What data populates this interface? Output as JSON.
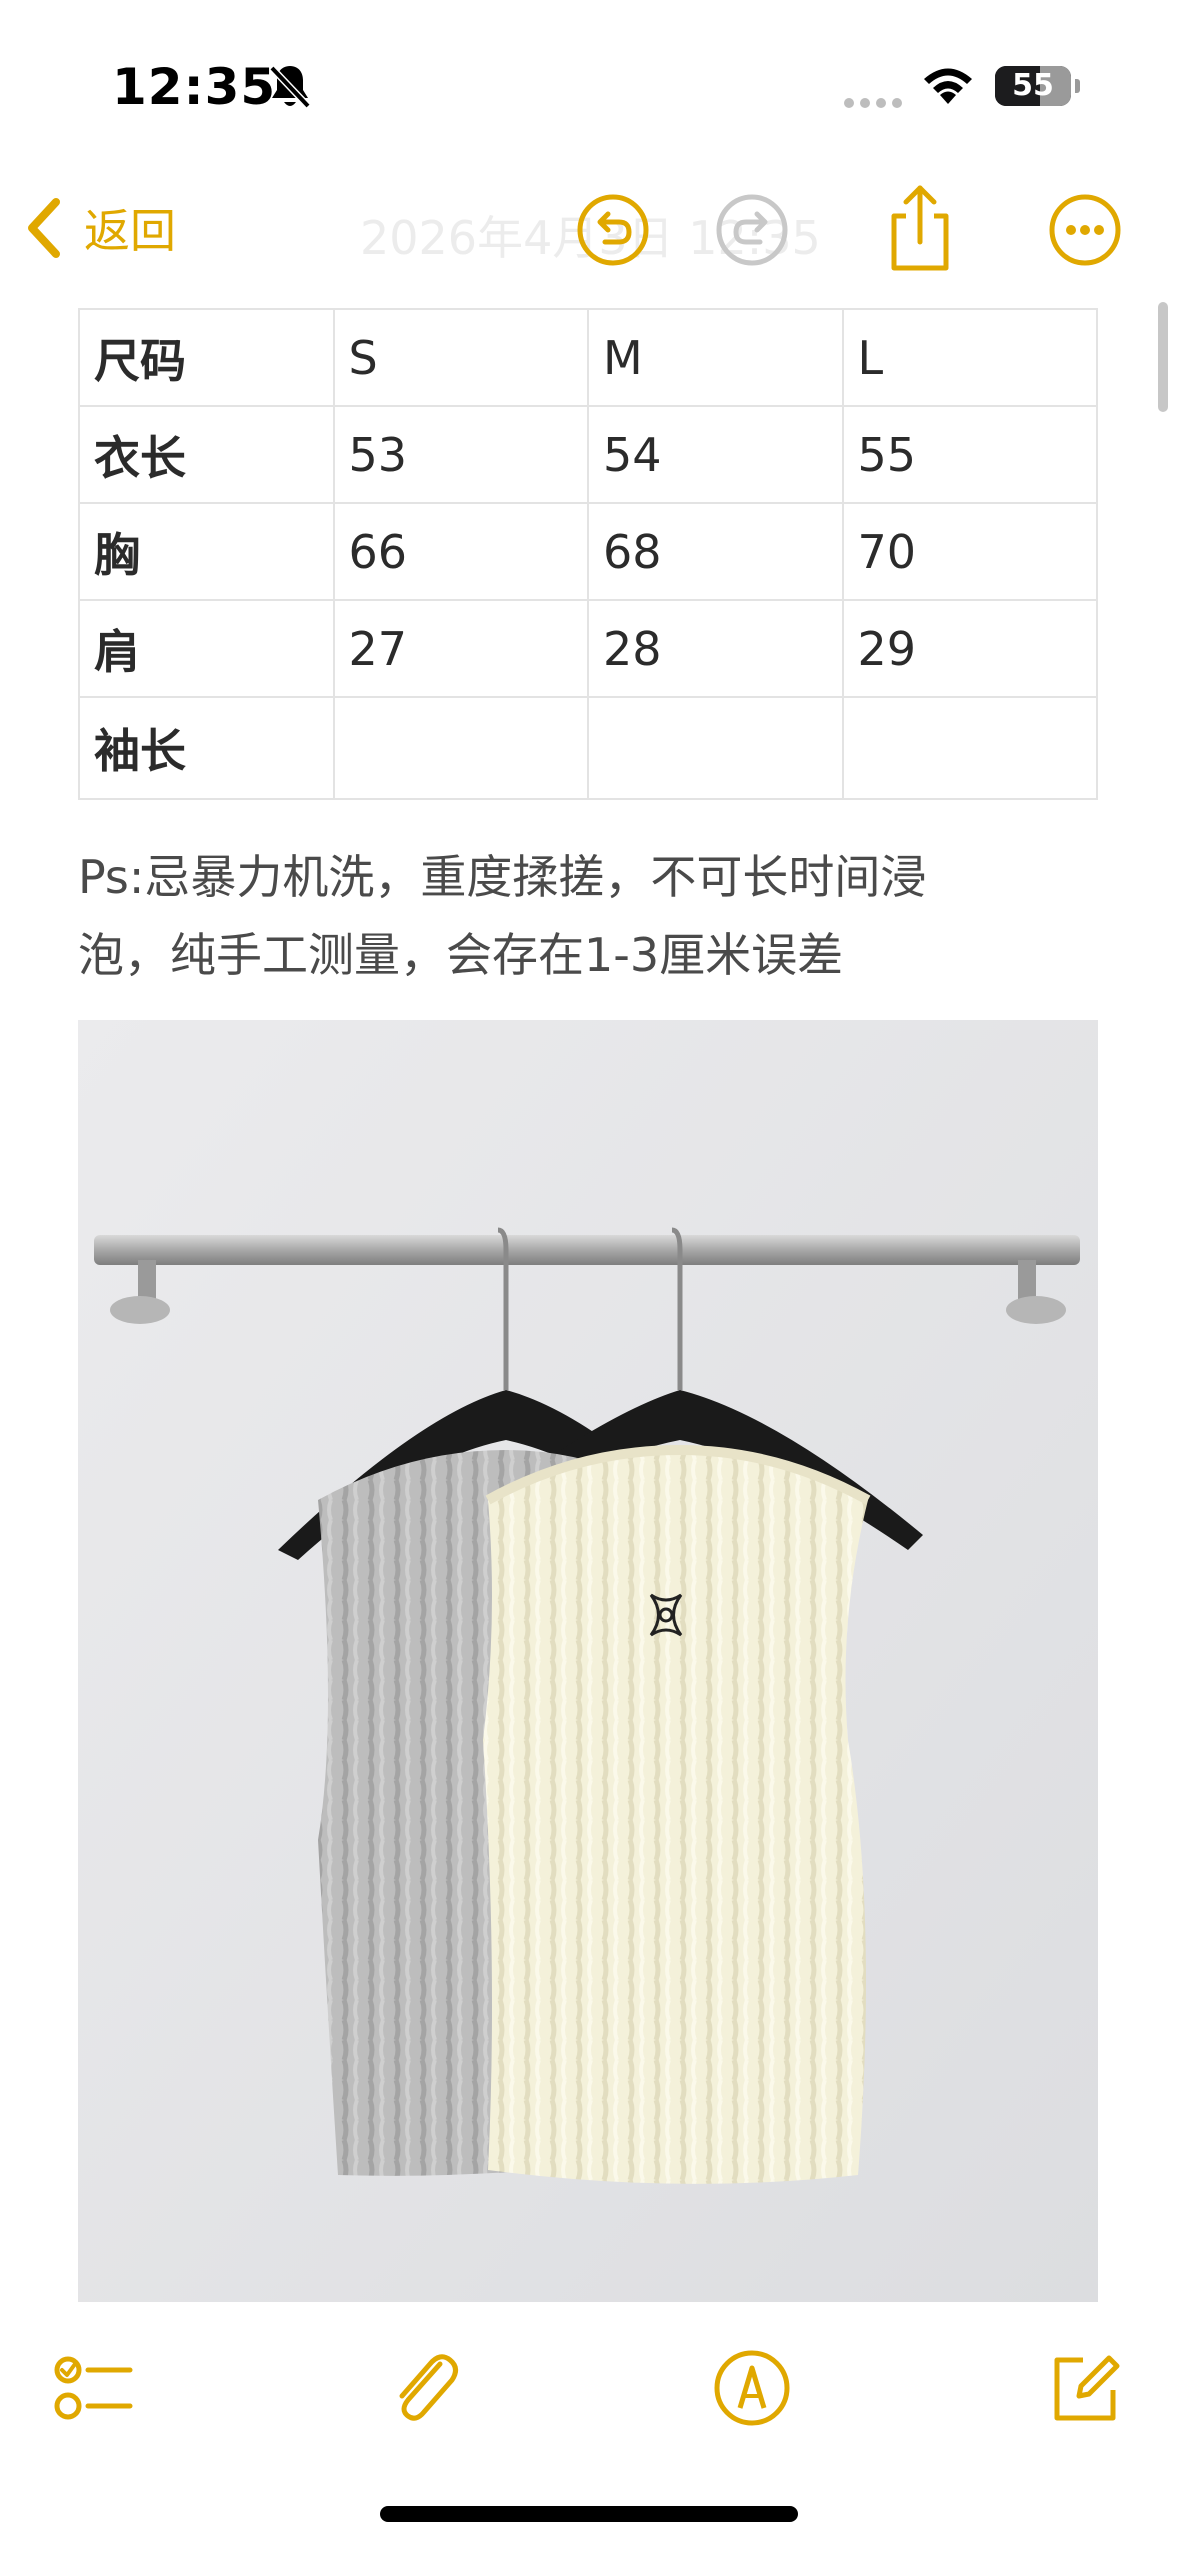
{
  "status_bar": {
    "time": "12:35",
    "battery": "55",
    "icons": [
      "bell-slash-icon",
      "cellular-dots-icon",
      "wifi-icon",
      "battery-icon"
    ]
  },
  "nav": {
    "back_label": "返回",
    "title": "2026年4月3日 12:35",
    "icons": [
      "chevron-left-icon",
      "undo-icon",
      "redo-icon",
      "share-icon",
      "more-icon"
    ]
  },
  "size_table": {
    "header": [
      "尺码",
      "S",
      "M",
      "L"
    ],
    "rows": [
      [
        "衣长",
        "53",
        "54",
        "55"
      ],
      [
        "胸",
        "66",
        "68",
        "70"
      ],
      [
        "肩",
        "27",
        "28",
        "29"
      ],
      [
        "袖长",
        "",
        "",
        ""
      ]
    ]
  },
  "note_text": {
    "line1": "Ps:忌暴力机洗，重度揉搓，不可长时间浸",
    "line2": "泡，纯手工测量，会存在1-3厘米误差"
  },
  "toolbar": {
    "icons": [
      "checklist-icon",
      "paperclip-icon",
      "markup-pen-icon",
      "compose-icon"
    ]
  },
  "colors": {
    "accent": "#E0A800",
    "disabled": "#C8C8C8"
  }
}
